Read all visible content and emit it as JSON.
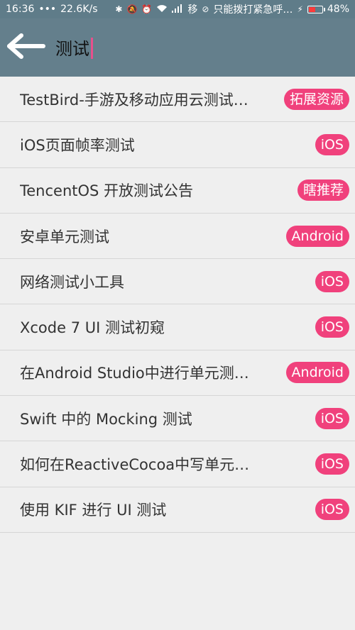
{
  "status_bar": {
    "time": "16:36",
    "dots": "•••",
    "network_speed": "22.6K/s",
    "carrier": "移",
    "emergency_text": "只能拨打紧急呼…",
    "battery_percent": "48%",
    "battery_level": 0.48,
    "battery_color": "#ff3b3b"
  },
  "search": {
    "query": "测试"
  },
  "results": [
    {
      "title": "TestBird-手游及移动应用云测试…",
      "tag": "拓展资源"
    },
    {
      "title": "iOS页面帧率测试",
      "tag": "iOS"
    },
    {
      "title": "TencentOS 开放测试公告",
      "tag": "瞎推荐"
    },
    {
      "title": "安卓单元测试",
      "tag": "Android"
    },
    {
      "title": "网络测试小工具",
      "tag": "iOS"
    },
    {
      "title": "Xcode 7 UI 测试初窥",
      "tag": "iOS"
    },
    {
      "title": "在Android Studio中进行单元测…",
      "tag": "Android"
    },
    {
      "title": "Swift 中的 Mocking 测试",
      "tag": "iOS"
    },
    {
      "title": "如何在ReactiveCocoa中写单元…",
      "tag": "iOS"
    },
    {
      "title": "使用 KIF 进行 UI 测试",
      "tag": "iOS"
    }
  ],
  "colors": {
    "app_bar": "#647f8c",
    "tag": "#f0417c",
    "cursor": "#e7508c"
  }
}
